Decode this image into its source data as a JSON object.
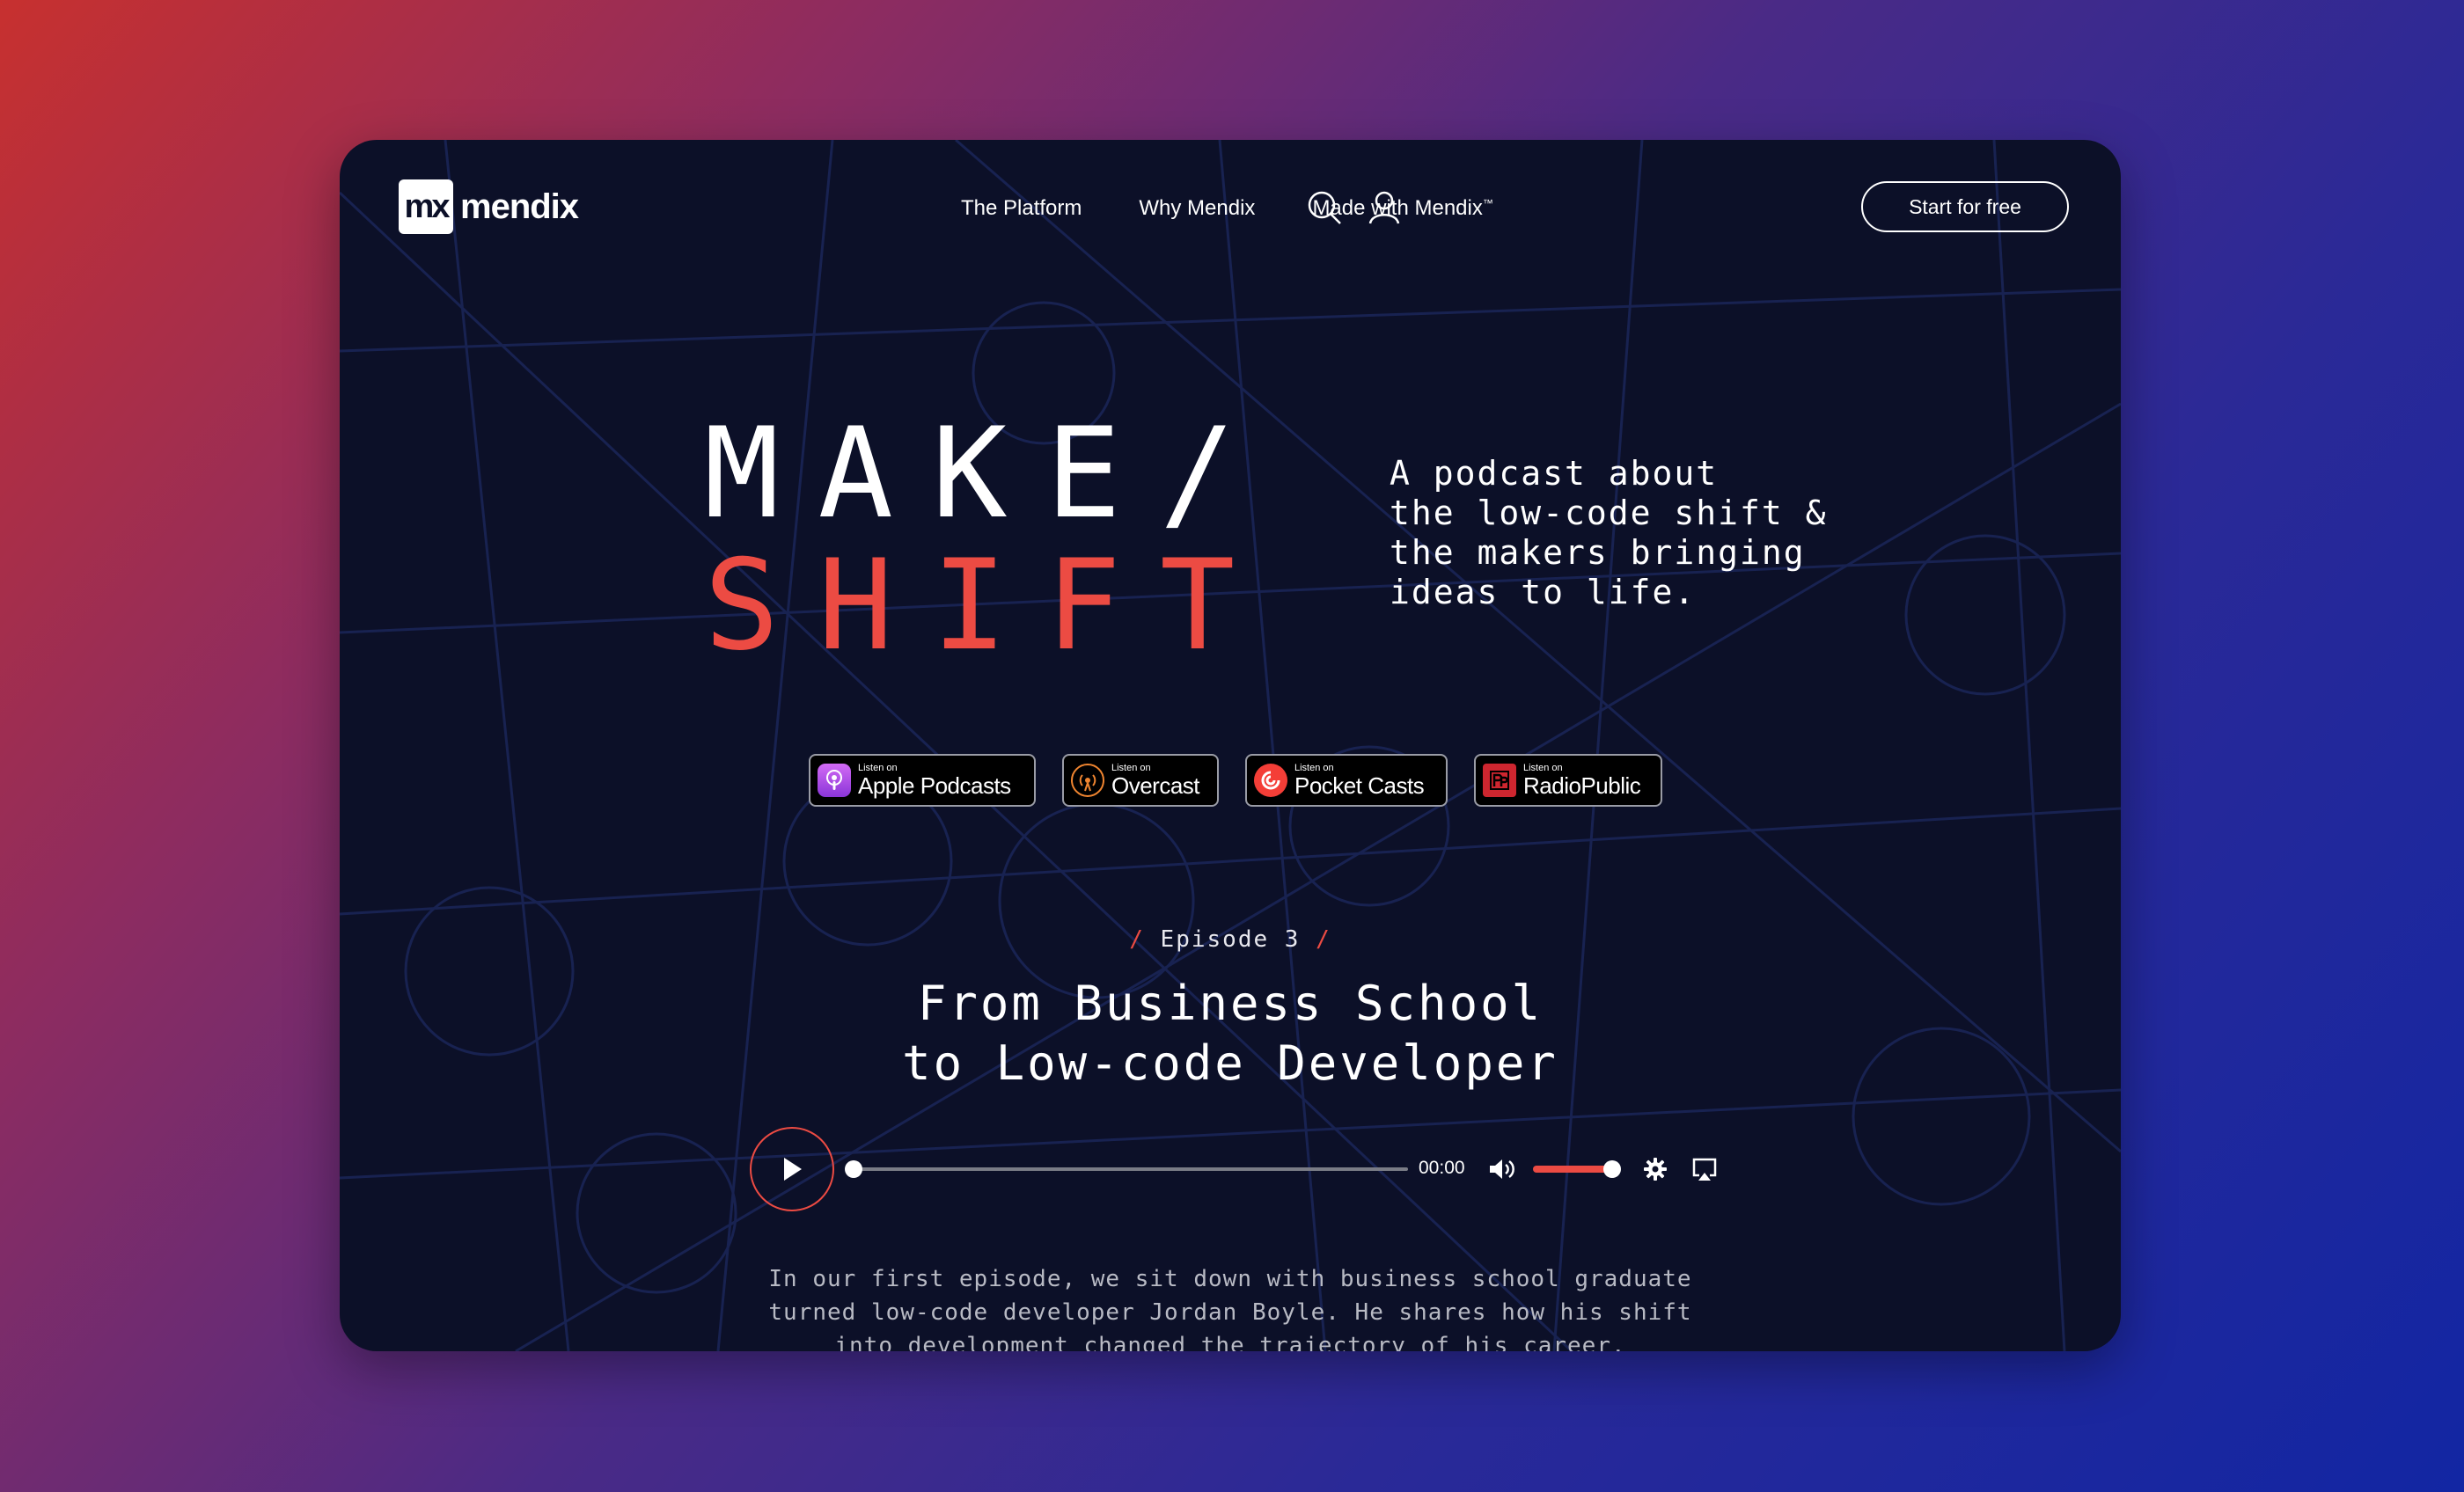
{
  "header": {
    "logo_mark": "mx",
    "logo_word": "mendix",
    "nav": [
      {
        "label": "The Platform"
      },
      {
        "label": "Why Mendix"
      },
      {
        "label": "Made with Mendix"
      }
    ],
    "nav_tm": "™",
    "cta": "Start for free"
  },
  "hero": {
    "title_line1": "MAKE/",
    "title_line2": "SHIFT",
    "tagline": "A podcast about\nthe low-code shift &\nthe makers bringing\nideas to life."
  },
  "badges": [
    {
      "small": "Listen on",
      "name": "Apple Podcasts",
      "icon": "apple-podcasts-icon",
      "color": "#a04fe0"
    },
    {
      "small": "Listen on",
      "name": "Overcast",
      "icon": "overcast-icon",
      "color": "#f08530"
    },
    {
      "small": "Listen on",
      "name": "Pocket Casts",
      "icon": "pocket-casts-icon",
      "color": "#f43e37"
    },
    {
      "small": "Listen on",
      "name": "RadioPublic",
      "icon": "radiopublic-icon",
      "color": "#ce262f"
    }
  ],
  "episode": {
    "slash": "/",
    "label": "Episode 3",
    "title_line1": "From Business School",
    "title_line2": "to Low-code Developer",
    "description": "In our first episode, we sit down with business school graduate\nturned low-code developer Jordan Boyle. He shares how his shift\ninto development changed the trajectory of his career."
  },
  "player": {
    "time": "00:00",
    "progress": 0,
    "volume": 1
  },
  "colors": {
    "accent": "#ec4b43",
    "card_bg": "#0c1028"
  }
}
